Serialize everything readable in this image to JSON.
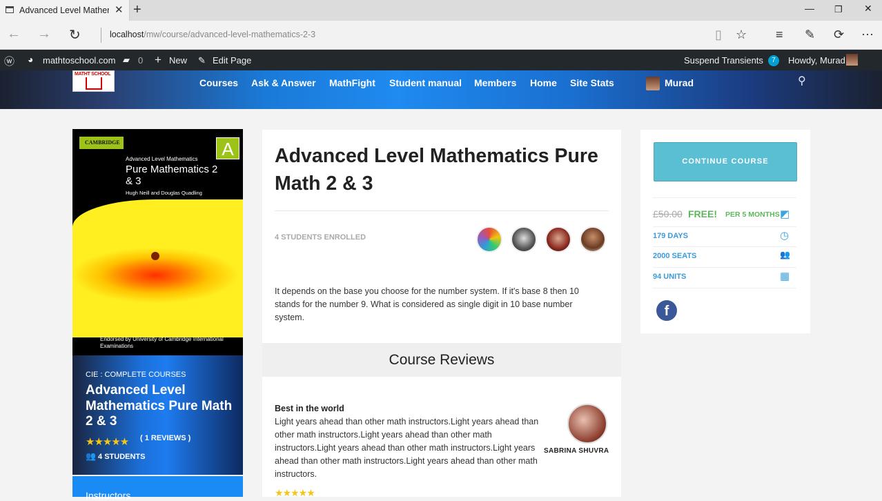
{
  "browser": {
    "tab_title": "Advanced Level Mathem",
    "url_host": "localhost",
    "url_path": "/mw/course/advanced-level-mathematics-2-3"
  },
  "adminbar": {
    "site": "mathtoschool.com",
    "comments": "0",
    "new_label": "New",
    "edit_label": "Edit Page",
    "suspend": "Suspend Transients",
    "badge": "7",
    "howdy": "Howdy, Murad"
  },
  "logo_text": "MATHT SCHOOL",
  "nav": {
    "items": [
      "Courses",
      "Ask & Answer",
      "MathFight",
      "Student manual",
      "Members",
      "Home",
      "Site Stats"
    ],
    "user": "Murad"
  },
  "cover": {
    "publisher": "CAMBRIDGE",
    "letter": "A",
    "series": "Advanced Level Mathematics",
    "book_title": "Pure Mathematics 2 & 3",
    "authors": "Hugh Neill and Douglas Quadling",
    "endorsed": "Endorsed by University of Cambridge International Examinations"
  },
  "sidebar": {
    "category": "CIE : COMPLETE COURSES",
    "title": "Advanced Level Mathematics Pure Math 2 & 3",
    "stars": "★★★★★",
    "reviews": "( 1 REVIEWS )",
    "students": "4 STUDENTS",
    "instructors_label": "Instructors"
  },
  "course": {
    "title": "Advanced Level Mathematics Pure Math 2 & 3",
    "enrolled": "4 STUDENTS ENROLLED",
    "description": "It depends on the base you choose for the number system. If it's base 8 then 10 stands for the number 9. What is considered as single digit in 10 base number system."
  },
  "reviews": {
    "heading": "Course Reviews",
    "title": "Best in the world",
    "body": "Light years ahead than other math instructors.Light years ahead than other math instructors.Light years ahead than other math instructors.Light years ahead than other math instructors.Light years ahead than other math instructors.Light years ahead than other math instructors.",
    "author": "SABRINA SHUVRA",
    "stars": "★★★★★"
  },
  "pricing": {
    "button": "CONTINUE COURSE",
    "old_price": "£50.00",
    "price": "FREE!",
    "period": "PER 5 MONTHS",
    "days": "179 DAYS",
    "seats": "2000 SEATS",
    "units": "94 UNITS",
    "facebook": "f"
  }
}
